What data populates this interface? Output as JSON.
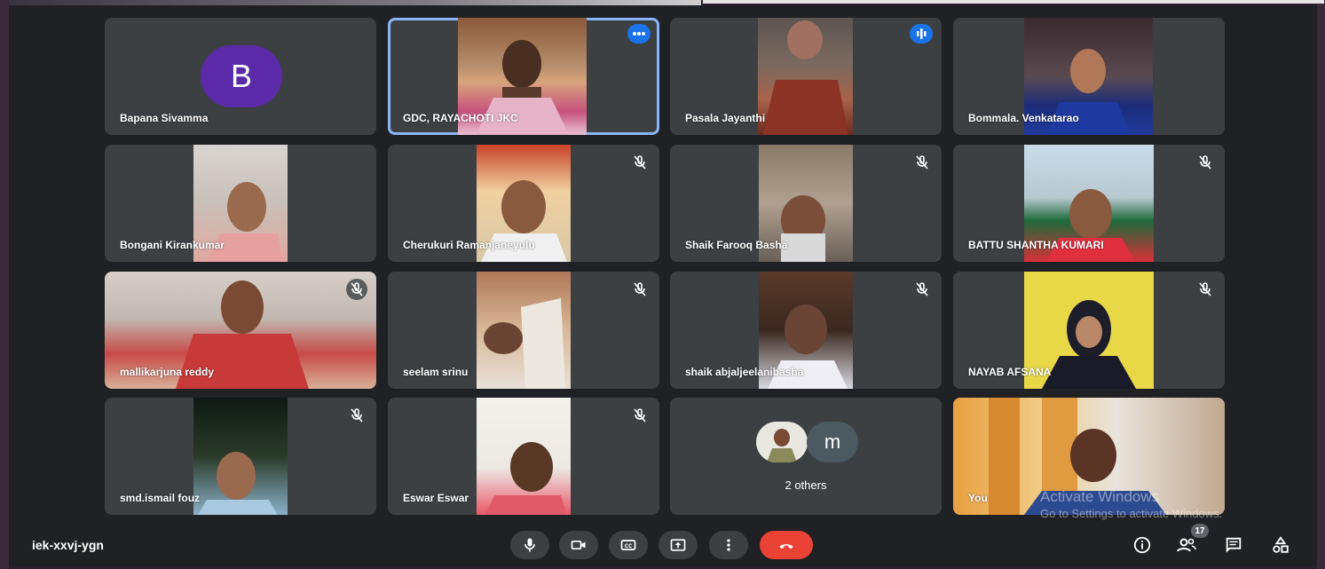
{
  "meeting": {
    "code": "iek-xxvj-ygn",
    "participant_count": "17"
  },
  "tiles": [
    {
      "name": "Bapana Sivamma",
      "avatar_letter": "B"
    },
    {
      "name": "GDC, RAYACHOTI JKC"
    },
    {
      "name": "Pasala Jayanthi"
    },
    {
      "name": "Bommala. Venkatarao"
    },
    {
      "name": "Bongani Kirankumar"
    },
    {
      "name": "Cherukuri Ramanjaneyulu"
    },
    {
      "name": "Shaik Farooq Basha"
    },
    {
      "name": "BATTU SHANTHA KUMARI"
    },
    {
      "name": "mallikarjuna reddy"
    },
    {
      "name": "seelam srinu"
    },
    {
      "name": "shaik abjaljeelanibasha"
    },
    {
      "name": "NAYAB AFSANA"
    },
    {
      "name": "smd.ismail fouz"
    },
    {
      "name": "Eswar Eswar"
    },
    {
      "name": "2 others",
      "avatar_letter": "m"
    },
    {
      "name": "You"
    }
  ],
  "watermark": {
    "line1": "Activate Windows",
    "line2": "Go to Settings to activate Windows."
  },
  "icons": {
    "mic": "microphone-icon",
    "camera": "camera-icon",
    "captions": "captions-icon",
    "present": "present-screen-icon",
    "more": "more-options-icon",
    "leave": "leave-call-icon",
    "info": "info-icon",
    "people": "people-icon",
    "chat": "chat-icon",
    "activities": "activities-icon"
  },
  "colors": {
    "background": "#202124",
    "tile": "#3c4043",
    "leave": "#ea4335",
    "accent": "#1a73e8",
    "avatar_b": "#5b2aa8"
  }
}
